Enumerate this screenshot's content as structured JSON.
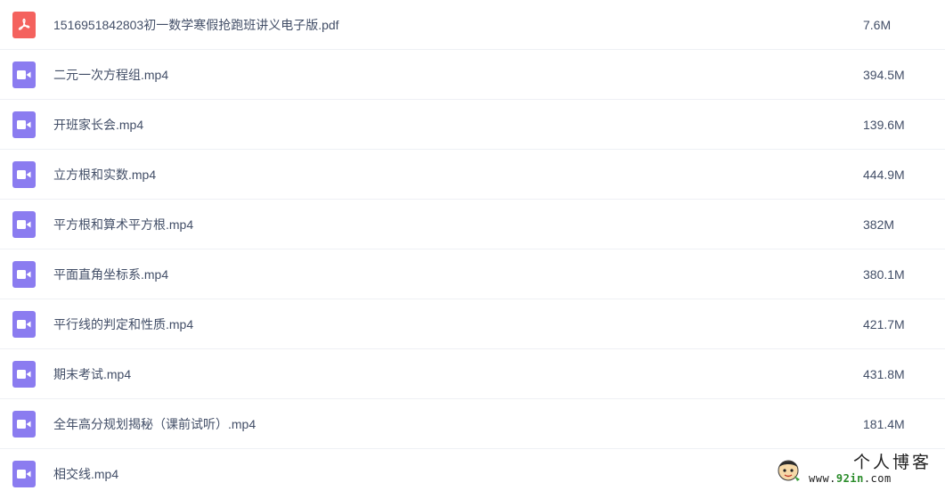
{
  "files": [
    {
      "name": "1516951842803初一数学寒假抢跑班讲义电子版.pdf",
      "size": "7.6M",
      "icon": "pdf-icon"
    },
    {
      "name": "二元一次方程组.mp4",
      "size": "394.5M",
      "icon": "video-icon"
    },
    {
      "name": "开班家长会.mp4",
      "size": "139.6M",
      "icon": "video-icon"
    },
    {
      "name": "立方根和实数.mp4",
      "size": "444.9M",
      "icon": "video-icon"
    },
    {
      "name": "平方根和算术平方根.mp4",
      "size": "382M",
      "icon": "video-icon"
    },
    {
      "name": "平面直角坐标系.mp4",
      "size": "380.1M",
      "icon": "video-icon"
    },
    {
      "name": "平行线的判定和性质.mp4",
      "size": "421.7M",
      "icon": "video-icon"
    },
    {
      "name": "期末考试.mp4",
      "size": "431.8M",
      "icon": "video-icon"
    },
    {
      "name": "全年高分规划揭秘（课前试听）.mp4",
      "size": "181.4M",
      "icon": "video-icon"
    },
    {
      "name": "相交线.mp4",
      "size": "",
      "icon": "video-icon"
    }
  ],
  "colors": {
    "pdf": "#f4625e",
    "video": "#8b7cf0",
    "text": "#424e67",
    "divider": "#eef0f4"
  },
  "watermark": {
    "title": "个人博客",
    "url_prefix": "www.",
    "url_highlight": "92in",
    "url_suffix": ".com"
  }
}
